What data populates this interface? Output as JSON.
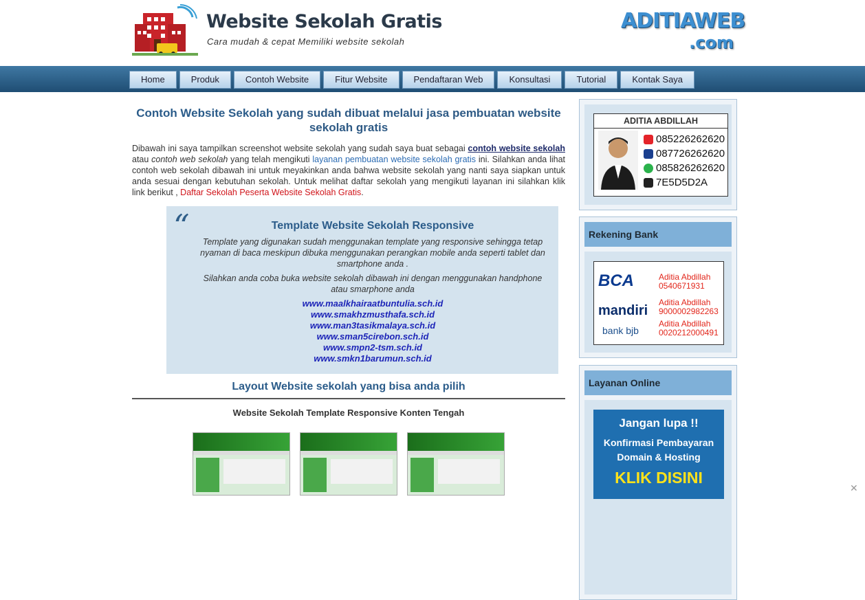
{
  "header": {
    "title": "Website Sekolah Gratis",
    "tagline": "Cara mudah & cepat Memiliki website sekolah",
    "brand_line1": "ADITIAWEB",
    "brand_line2": ".com"
  },
  "nav": {
    "items": [
      "Home",
      "Produk",
      "Contoh Website",
      "Fitur Website",
      "Pendaftaran Web",
      "Konsultasi",
      "Tutorial",
      "Kontak Saya"
    ]
  },
  "main": {
    "heading_strong": "Contoh Website Sekolah",
    "heading_rest": "yang sudah dibuat melalui jasa pembuatan website sekolah gratis",
    "intro_1": "Dibawah ini saya tampilkan screenshot website sekolah yang sudah saya buat sebagai ",
    "intro_link_contoh": "contoh website sekolah",
    "intro_2": " atau ",
    "intro_italic": "contoh web sekolah",
    "intro_3": " yang telah mengikuti ",
    "intro_link_layanan": "layanan pembuatan website sekolah gratis",
    "intro_4": " ini. Silahkan anda lihat contoh web sekolah dibawah ini untuk meyakinkan anda bahwa website sekolah yang nanti saya siapkan untuk anda sesuai dengan kebutuhan sekolah. Untuk melihat daftar sekolah yang mengikuti layanan ini silahkan klik link berikut , ",
    "intro_link_daftar": "Daftar Sekolah Peserta Website Sekolah Gratis",
    "intro_end": ".",
    "quote": {
      "title": "Template Website Sekolah Responsive",
      "p1": "Template yang digunakan sudah menggunakan template yang responsive sehingga tetap nyaman di baca meskipun dibuka menggunakan perangkan mobile anda seperti tablet dan smartphone anda .",
      "p2": "Silahkan anda coba buka website sekolah dibawah ini dengan menggunakan handphone atau smarphone anda",
      "links": [
        "www.maalkhairaatbuntulia.sch.id",
        "www.smakhzmusthafa.sch.id",
        "www.man3tasikmalaya.sch.id",
        "www.sman5cirebon.sch.id",
        "www.smpn2-tsm.sch.id",
        "www.smkn1barumun.sch.id"
      ]
    },
    "layout_heading": "Layout Website sekolah yang bisa anda pilih",
    "layout_subheading": "Website Sekolah Template Responsive Konten Tengah"
  },
  "sidebar": {
    "contact": {
      "name": "ADITIA ABDILLAH",
      "phones": [
        "085226262620",
        "087726262620",
        "085826262620",
        "7E5D5D2A"
      ]
    },
    "bank": {
      "heading": "Rekening Bank",
      "accounts": [
        {
          "bank": "BCA",
          "holder": "Aditia Abdillah",
          "number": "0540671931"
        },
        {
          "bank": "mandiri",
          "holder": "Aditia Abdillah",
          "number": "9000002982263"
        },
        {
          "bank": "bank bjb",
          "holder": "Aditia Abdillah",
          "number": "0020212000491"
        }
      ]
    },
    "online": {
      "heading": "Layanan Online",
      "promo_1": "Jangan lupa  !!",
      "promo_2": "Konfirmasi Pembayaran",
      "promo_3": "Domain & Hosting",
      "promo_4": "KLIK DISINI"
    }
  },
  "colors": {
    "nav_bar": "#2a5d86",
    "accent_blue": "#2b5c8a",
    "link_red": "#d0141a",
    "quote_bg": "#d4e3ee",
    "sidebar_head": "#7fb0d8"
  }
}
